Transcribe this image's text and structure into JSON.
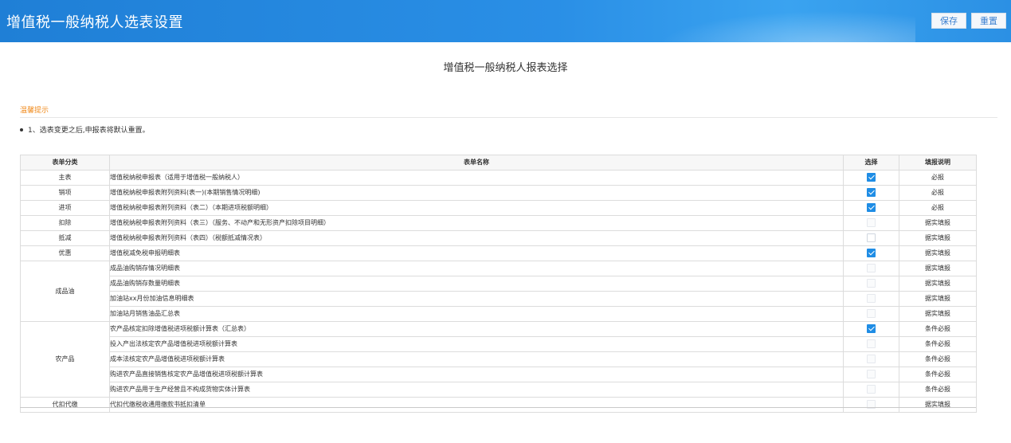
{
  "header": {
    "title": "增值税一般纳税人选表设置",
    "save_label": "保存",
    "reset_label": "重置"
  },
  "page_title": "增值税一般纳税人报表选择",
  "tips": {
    "title": "温馨提示",
    "items": [
      "1、选表变更之后,申报表将默认重置。"
    ]
  },
  "table": {
    "columns": [
      "表单分类",
      "表单名称",
      "选择",
      "填报说明"
    ],
    "rows": [
      {
        "category": "主表",
        "name": "增值税纳税申报表（适用于增值税一般纳税人）",
        "checked": true,
        "disabled": false,
        "note": "必报"
      },
      {
        "category": "销项",
        "name": "增值税纳税申报表附列资料(表一)(本期销售情况明细)",
        "checked": true,
        "disabled": false,
        "note": "必报"
      },
      {
        "category": "进项",
        "name": "增值税纳税申报表附列资料（表二）（本期进项税额明细）",
        "checked": true,
        "disabled": false,
        "note": "必报"
      },
      {
        "category": "扣除",
        "name": "增值税纳税申报表附列资料（表三）（服务、不动产和无形资产扣除项目明细）",
        "checked": false,
        "disabled": true,
        "note": "据实填报"
      },
      {
        "category": "抵减",
        "name": "增值税纳税申报表附列资料（表四）（税额抵减情况表）",
        "checked": false,
        "disabled": false,
        "note": "据实填报"
      },
      {
        "category": "优惠",
        "name": "增值税减免税申报明细表",
        "checked": true,
        "disabled": false,
        "note": "据实填报"
      },
      {
        "category": "成品油",
        "name": "成品油购销存情况明细表",
        "checked": false,
        "disabled": true,
        "note": "据实填报"
      },
      {
        "category": "成品油",
        "name": "成品油购销存数量明细表",
        "checked": false,
        "disabled": true,
        "note": "据实填报"
      },
      {
        "category": "成品油",
        "name": "加油站xx月份加油信息明细表",
        "checked": false,
        "disabled": true,
        "note": "据实填报"
      },
      {
        "category": "成品油",
        "name": "加油站月销售油品汇总表",
        "checked": false,
        "disabled": true,
        "note": "据实填报"
      },
      {
        "category": "农产品",
        "name": "农产品核定扣除增值税进项税额计算表（汇总表）",
        "checked": true,
        "disabled": false,
        "note": "条件必报"
      },
      {
        "category": "农产品",
        "name": "投入产出法核定农产品增值税进项税额计算表",
        "checked": false,
        "disabled": true,
        "note": "条件必报"
      },
      {
        "category": "农产品",
        "name": "成本法核定农产品增值税进项税额计算表",
        "checked": false,
        "disabled": true,
        "note": "条件必报"
      },
      {
        "category": "农产品",
        "name": "购进农产品直接销售核定农产品增值税进项税额计算表",
        "checked": false,
        "disabled": true,
        "note": "条件必报"
      },
      {
        "category": "农产品",
        "name": "购进农产品用于生产经营且不构成货物实体计算表",
        "checked": false,
        "disabled": true,
        "note": "条件必报"
      },
      {
        "category": "代扣代缴",
        "name": "代扣代缴税收通用缴款书抵扣清单",
        "checked": false,
        "disabled": true,
        "note": "据实填报"
      }
    ]
  },
  "colors": {
    "header_blue": "#2a8fe6",
    "checkbox_blue": "#1f8de5",
    "tip_orange": "#f08a1b"
  }
}
